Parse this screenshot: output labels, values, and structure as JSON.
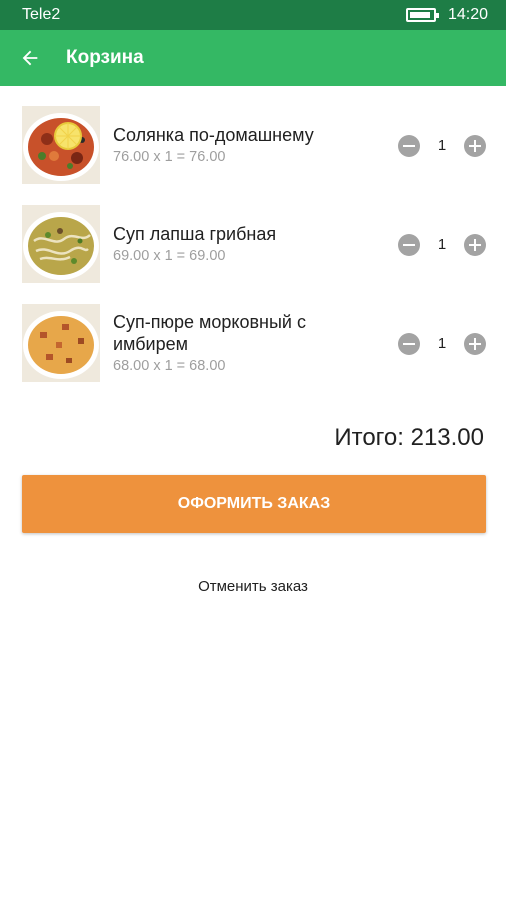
{
  "status_bar": {
    "carrier": "Tele2",
    "time": "14:20",
    "battery_level": 0.9
  },
  "app_bar": {
    "title": "Корзина",
    "back_icon": "arrow-left-icon"
  },
  "cart": {
    "items": [
      {
        "name": "Солянка по-домашнему",
        "calc": "76.00 x 1 = 76.00",
        "qty": "1",
        "image": "solyanka-soup"
      },
      {
        "name": "Суп лапша грибная",
        "calc": "69.00 x 1 = 69.00",
        "qty": "1",
        "image": "mushroom-noodle-soup"
      },
      {
        "name": "Суп-пюре морковный с имбирем",
        "calc": "68.00 x 1 = 68.00",
        "qty": "1",
        "image": "carrot-ginger-puree-soup"
      }
    ],
    "total": "Итого: 213.00"
  },
  "actions": {
    "checkout": "ОФОРМИТЬ ЗАКАЗ",
    "cancel": "Отменить заказ"
  },
  "colors": {
    "status_bar": "#1e7d46",
    "app_bar": "#34b864",
    "accent": "#ee923d",
    "qty_button": "#a3a3a3"
  }
}
